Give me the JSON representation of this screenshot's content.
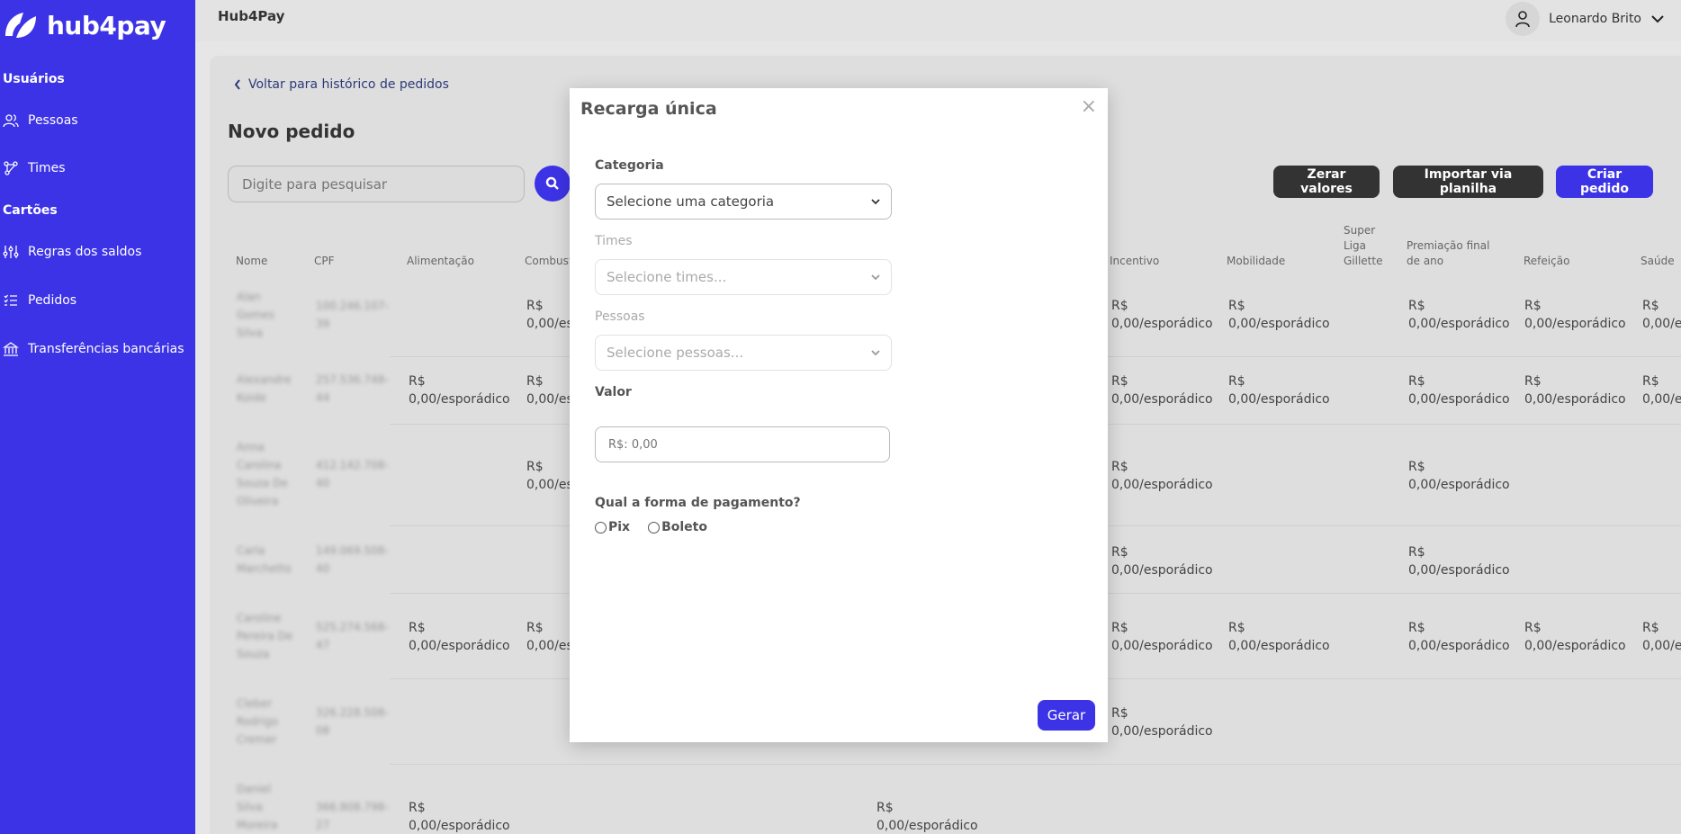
{
  "sidebar": {
    "brand": "hub4pay",
    "sections": [
      {
        "label": "Usuários"
      },
      {
        "label": "Cartões"
      }
    ],
    "items": [
      {
        "label": "Pessoas",
        "icon": "users-icon"
      },
      {
        "label": "Times",
        "icon": "network-icon"
      },
      {
        "label": "Regras dos saldos",
        "icon": "sliders-icon"
      },
      {
        "label": "Pedidos",
        "icon": "list-icon"
      },
      {
        "label": "Transferências bancárias",
        "icon": "bank-icon"
      }
    ],
    "color": "#3d33e6"
  },
  "topbar": {
    "title": "Hub4Pay",
    "user_name": "Leonardo Brito"
  },
  "main": {
    "back_link": "Voltar para histórico de pedidos",
    "page_title": "Novo pedido",
    "search_placeholder": "Digite para pesquisar",
    "buttons": {
      "reset": "Zerar valores",
      "import": "Importar via planilha",
      "create": "Criar pedido"
    },
    "columns": {
      "nome": "Nome",
      "cpf": "CPF",
      "alimentacao": "Alimentação",
      "combustivel": "Combust",
      "incentivo": "Incentivo",
      "mobilidade": "Mobilidade",
      "super_liga": "Super Liga Gillette",
      "premiacao": "Premiação final de ano",
      "refeicao": "Refeição",
      "saude": "Saúde"
    },
    "rows": [
      {
        "name": "Alan Gomes Silva",
        "cpf": "100.246.107-39"
      },
      {
        "name": "Alexandre Koide",
        "cpf": "257.536.748-44"
      },
      {
        "name": "Anna Carolina Souza De Oliveira",
        "cpf": "412.142.708-40"
      },
      {
        "name": "Carla Marchetto",
        "cpf": "149.069.508-40"
      },
      {
        "name": "Caroline Pereira De Souza",
        "cpf": "525.274.568-47"
      },
      {
        "name": "Cleber Rodrigo Cremer",
        "cpf": "326.228.508-08"
      },
      {
        "name": "Daniel Silva Moreira",
        "cpf": "366.808.798-27"
      }
    ],
    "cell_value": "R$ 0,00/esporádico",
    "cell_currency": "R$",
    "cell_amount": "0,00/esporádico",
    "cell_partial": "0,00/es",
    "cell_partial_e": "0,00/e"
  },
  "modal": {
    "title": "Recarga única",
    "close": "×",
    "categoria_label": "Categoria",
    "categoria_placeholder": "Selecione uma categoria",
    "times_label": "Times",
    "times_placeholder": "Selecione times...",
    "pessoas_label": "Pessoas",
    "pessoas_placeholder": "Selecione pessoas...",
    "valor_label": "Valor",
    "valor_placeholder": "R$: 0,00",
    "payment_question": "Qual a forma de pagamento?",
    "payment_options": [
      "Pix",
      "Boleto"
    ],
    "submit": "Gerar"
  }
}
